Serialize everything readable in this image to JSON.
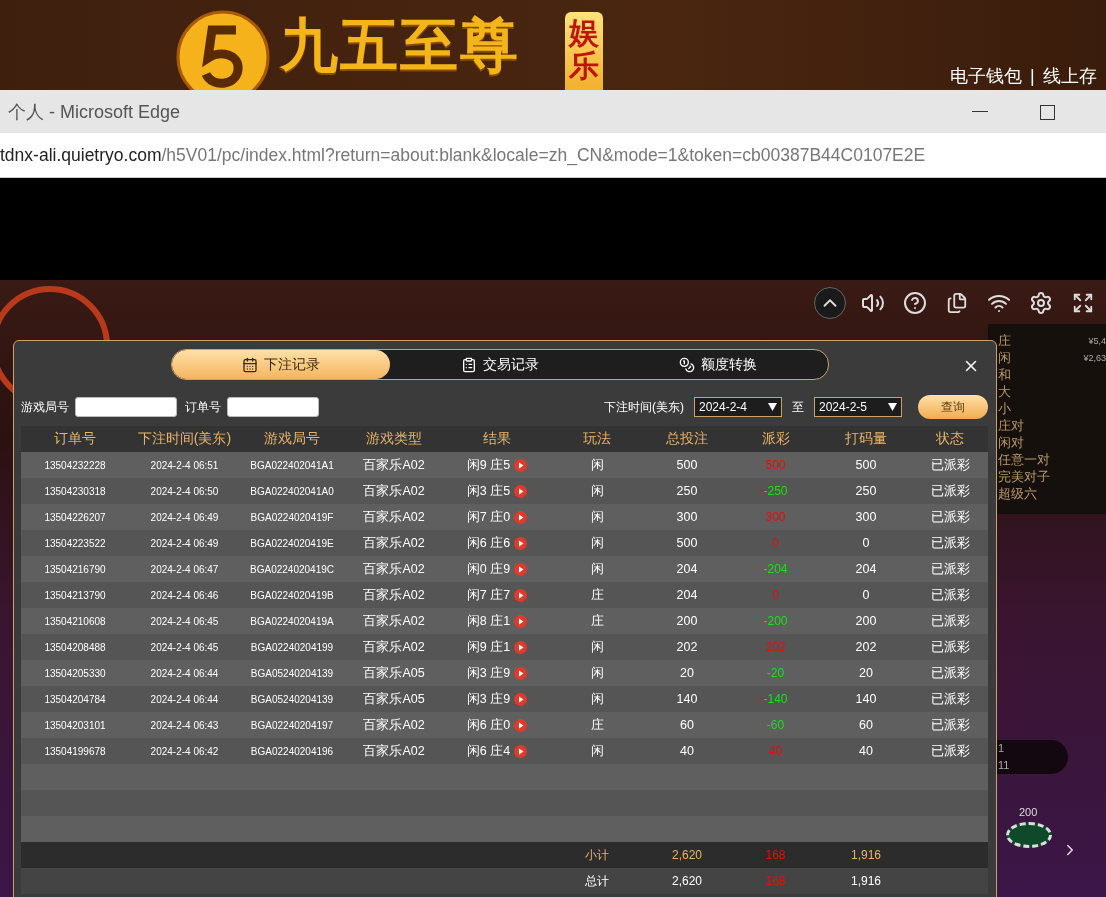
{
  "banner": {
    "logo_text": "九五至尊",
    "logo_badge": "娱乐",
    "links": [
      "电子钱包",
      "线上存"
    ],
    "separator": "|"
  },
  "browser": {
    "title": "个人 - Microsoft Edge",
    "url_host": "tdnx-ali.quietryo.com",
    "url_path": "/h5V01/pc/index.html?return=about:blank&locale=zh_CN&mode=1&token=cb00387B44C0107E2E"
  },
  "game": {
    "bet_types": [
      {
        "name": "庄",
        "amount": "¥5,4"
      },
      {
        "name": "闲",
        "amount": "¥2,63"
      },
      {
        "name": "和"
      },
      {
        "name": "大"
      },
      {
        "name": "小"
      },
      {
        "name": "庄对"
      },
      {
        "name": "闲对"
      },
      {
        "name": "任意一对"
      },
      {
        "name": "完美对子"
      },
      {
        "name": "超级六"
      }
    ],
    "road": [
      "1",
      "11"
    ],
    "chip": "200"
  },
  "dialog": {
    "tabs": [
      {
        "label": "下注记录",
        "kind": "calendar",
        "selected": true
      },
      {
        "label": "交易记录",
        "kind": "clipboard",
        "selected": false
      },
      {
        "label": "额度转换",
        "kind": "coins",
        "selected": false
      }
    ],
    "filters": {
      "game_no_label": "游戏局号",
      "order_no_label": "订单号",
      "time_label": "下注时间(美东)",
      "from": "2024-2-4",
      "to_label": "至",
      "to": "2024-2-5",
      "query": "查询"
    },
    "columns": [
      "订单号",
      "下注时间(美东)",
      "游戏局号",
      "游戏类型",
      "结果",
      "玩法",
      "总投注",
      "派彩",
      "打码量",
      "状态"
    ],
    "rows": [
      {
        "order": "13504232228",
        "time": "2024-2-4 06:51",
        "game_no": "BGA022402041A1",
        "game_type": "百家乐A02",
        "result": "闲9 庄5",
        "play": "闲",
        "bet": "500",
        "payout": "500",
        "color": "#e01010",
        "valid": "500",
        "status": "已派彩"
      },
      {
        "order": "13504230318",
        "time": "2024-2-4 06:50",
        "game_no": "BGA022402041A0",
        "game_type": "百家乐A02",
        "result": "闲3 庄5",
        "play": "闲",
        "bet": "250",
        "payout": "-250",
        "color": "#19e019",
        "valid": "250",
        "status": "已派彩"
      },
      {
        "order": "13504226207",
        "time": "2024-2-4 06:49",
        "game_no": "BGA0224020419F",
        "game_type": "百家乐A02",
        "result": "闲7 庄0",
        "play": "闲",
        "bet": "300",
        "payout": "300",
        "color": "#e01010",
        "valid": "300",
        "status": "已派彩"
      },
      {
        "order": "13504223522",
        "time": "2024-2-4 06:49",
        "game_no": "BGA0224020419E",
        "game_type": "百家乐A02",
        "result": "闲6 庄6",
        "play": "闲",
        "bet": "500",
        "payout": "0",
        "color": "#e01010",
        "valid": "0",
        "status": "已派彩"
      },
      {
        "order": "13504216790",
        "time": "2024-2-4 06:47",
        "game_no": "BGA0224020419C",
        "game_type": "百家乐A02",
        "result": "闲0 庄9",
        "play": "闲",
        "bet": "204",
        "payout": "-204",
        "color": "#19e019",
        "valid": "204",
        "status": "已派彩"
      },
      {
        "order": "13504213790",
        "time": "2024-2-4 06:46",
        "game_no": "BGA0224020419B",
        "game_type": "百家乐A02",
        "result": "闲7 庄7",
        "play": "庄",
        "bet": "204",
        "payout": "0",
        "color": "#e01010",
        "valid": "0",
        "status": "已派彩"
      },
      {
        "order": "13504210608",
        "time": "2024-2-4 06:45",
        "game_no": "BGA0224020419A",
        "game_type": "百家乐A02",
        "result": "闲8 庄1",
        "play": "庄",
        "bet": "200",
        "payout": "-200",
        "color": "#19e019",
        "valid": "200",
        "status": "已派彩"
      },
      {
        "order": "13504208488",
        "time": "2024-2-4 06:45",
        "game_no": "BGA02240204199",
        "game_type": "百家乐A02",
        "result": "闲9 庄1",
        "play": "闲",
        "bet": "202",
        "payout": "202",
        "color": "#e01010",
        "valid": "202",
        "status": "已派彩"
      },
      {
        "order": "13504205330",
        "time": "2024-2-4 06:44",
        "game_no": "BGA05240204139",
        "game_type": "百家乐A05",
        "result": "闲3 庄9",
        "play": "闲",
        "bet": "20",
        "payout": "-20",
        "color": "#19e019",
        "valid": "20",
        "status": "已派彩"
      },
      {
        "order": "13504204784",
        "time": "2024-2-4 06:44",
        "game_no": "BGA05240204139",
        "game_type": "百家乐A05",
        "result": "闲3 庄9",
        "play": "闲",
        "bet": "140",
        "payout": "-140",
        "color": "#19e019",
        "valid": "140",
        "status": "已派彩"
      },
      {
        "order": "13504203101",
        "time": "2024-2-4 06:43",
        "game_no": "BGA02240204197",
        "game_type": "百家乐A02",
        "result": "闲6 庄0",
        "play": "庄",
        "bet": "60",
        "payout": "-60",
        "color": "#19e019",
        "valid": "60",
        "status": "已派彩"
      },
      {
        "order": "13504199678",
        "time": "2024-2-4 06:42",
        "game_no": "BGA02240204196",
        "game_type": "百家乐A02",
        "result": "闲6 庄4",
        "play": "闲",
        "bet": "40",
        "payout": "40",
        "color": "#e01010",
        "valid": "40",
        "status": "已派彩"
      }
    ],
    "subtotal": {
      "label": "小计",
      "bet": "2,620",
      "payout": "168",
      "valid": "1,916"
    },
    "total": {
      "label": "总计",
      "bet": "2,620",
      "payout": "168",
      "valid": "1,916"
    }
  }
}
